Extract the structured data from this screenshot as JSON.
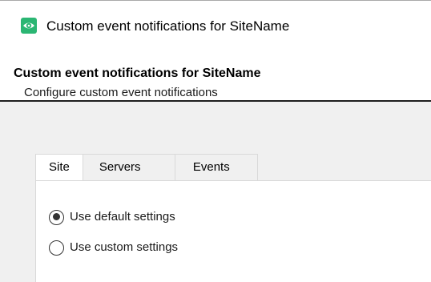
{
  "window": {
    "title": "Custom event notifications for SiteName",
    "icon": "eye-icon",
    "icon_color": "#2bb673"
  },
  "header": {
    "title": "Custom event notifications for SiteName",
    "subtitle": "Configure custom event notifications"
  },
  "tabs": [
    {
      "label": "Site",
      "active": true
    },
    {
      "label": "Servers",
      "active": false
    },
    {
      "label": "Events",
      "active": false
    }
  ],
  "settings": {
    "options": [
      {
        "label": "Use default settings",
        "checked": true
      },
      {
        "label": "Use custom settings",
        "checked": false
      }
    ]
  },
  "colors": {
    "content_background": "#f0f0f0",
    "panel_background": "#ffffff"
  }
}
